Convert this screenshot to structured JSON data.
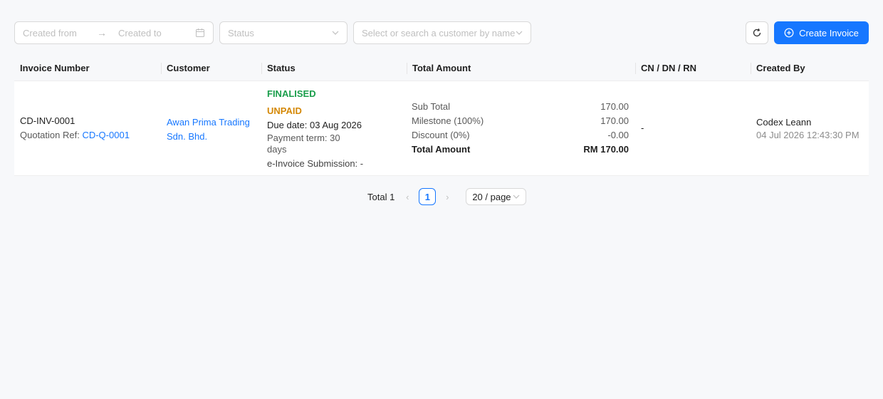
{
  "filters": {
    "created_from_placeholder": "Created from",
    "created_to_placeholder": "Created to",
    "status_placeholder": "Status",
    "customer_placeholder": "Select or search a customer by name"
  },
  "actions": {
    "create_invoice_label": "Create Invoice"
  },
  "columns": [
    "Invoice Number",
    "Customer",
    "Status",
    "Total Amount",
    "CN / DN / RN",
    "Created By"
  ],
  "rows": [
    {
      "invoice_number": "CD-INV-0001",
      "quotation_ref_label": "Quotation Ref:",
      "quotation_ref": "CD-Q-0001",
      "customer_line1": "Awan Prima Trading",
      "customer_line2": "Sdn. Bhd.",
      "status_primary": "FINALISED",
      "status_payment": "UNPAID",
      "due_date": "Due date: 03 Aug 2026",
      "payment_term_line1": "Payment term: 30",
      "payment_term_line2": "days",
      "einvoice": "e-Invoice Submission: -",
      "amounts": {
        "sub_total_label": "Sub Total",
        "sub_total": "170.00",
        "milestone_label": "Milestone (100%)",
        "milestone": "170.00",
        "discount_label": "Discount (0%)",
        "discount": "-0.00",
        "total_label": "Total Amount",
        "total": "RM 170.00"
      },
      "cn_dn_rn": "-",
      "created_by": "Codex Leann",
      "created_at": "04 Jul 2026 12:43:30 PM"
    }
  ],
  "pagination": {
    "total": "Total 1",
    "current_page": "1",
    "page_size": "20 / page"
  },
  "colors": {
    "primary": "#1677ff",
    "finalised": "#1a9e4b",
    "unpaid": "#d48806"
  }
}
